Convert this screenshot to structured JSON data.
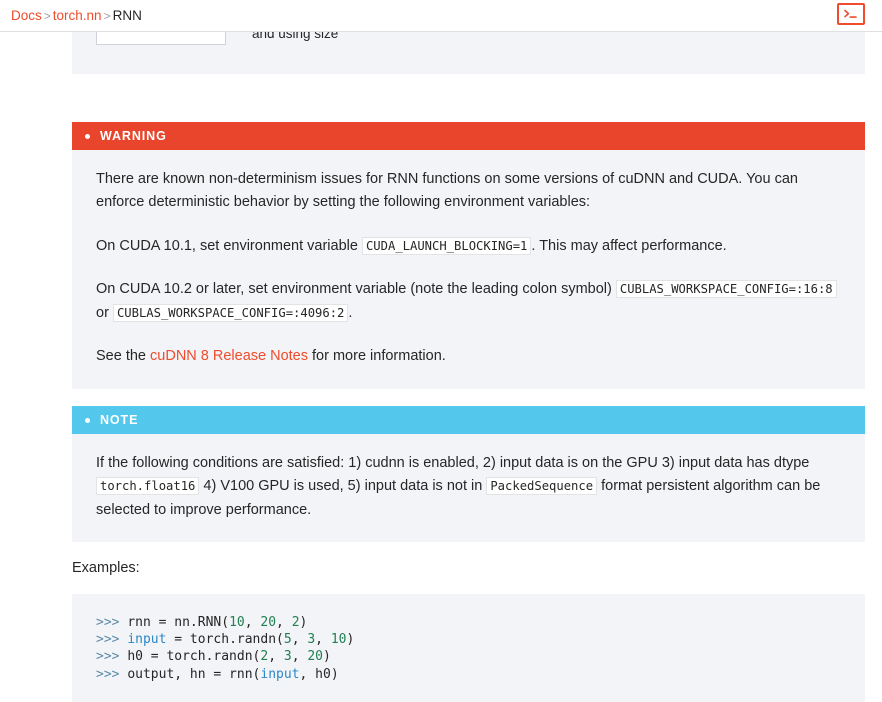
{
  "breadcrumb": {
    "items": [
      {
        "label": "Docs",
        "link": true
      },
      {
        "label": "torch.nn",
        "link": true
      },
      {
        "label": "RNN",
        "link": false
      }
    ],
    "separator": ">"
  },
  "topbar": {
    "shell_button_name": "Shell",
    "shell_glyph": ">_"
  },
  "colors": {
    "accent": "#ee4c2c",
    "warning": "#e8452c",
    "note": "#54c7ec",
    "admonition_bg": "#f3f4f7",
    "text": "#262626",
    "code_number": "#208050",
    "code_name": "#2b87c8",
    "code_prompt": "#5d8aa8"
  },
  "cutoff": {
    "trailing_text": "and using size"
  },
  "warning": {
    "title": "WARNING",
    "paragraphs": {
      "p1": "There are known non-determinism issues for RNN functions on some versions of cuDNN and CUDA. You can enforce deterministic behavior by setting the following environment variables:",
      "p2_before": "On CUDA 10.1, set environment variable",
      "p2_code": "CUDA_LAUNCH_BLOCKING=1",
      "p2_after": ". This may affect performance.",
      "p3_before": "On CUDA 10.2 or later, set environment variable (note the leading colon symbol)",
      "p3_code1": "CUBLAS_WORKSPACE_CONFIG=:16:8",
      "p3_mid": "or",
      "p3_code2": "CUBLAS_WORKSPACE_CONFIG=:4096:2",
      "p3_after": ".",
      "p4_before": "See the",
      "p4_link": "cuDNN 8 Release Notes",
      "p4_after": "for more information."
    }
  },
  "note": {
    "title": "NOTE",
    "body": {
      "before": "If the following conditions are satisfied: 1) cudnn is enabled, 2) input data is on the GPU 3) input data has dtype",
      "code1": "torch.float16",
      "mid": "4) V100 GPU is used, 5) input data is not in",
      "code2": "PackedSequence",
      "after": "format persistent algorithm can be selected to improve performance."
    }
  },
  "examples": {
    "label": "Examples:",
    "lines": [
      [
        {
          "t": ">>> ",
          "c": "prompt"
        },
        {
          "t": "rnn = nn.RNN(",
          "c": "plain"
        },
        {
          "t": "10",
          "c": "num"
        },
        {
          "t": ", ",
          "c": "plain"
        },
        {
          "t": "20",
          "c": "num"
        },
        {
          "t": ", ",
          "c": "plain"
        },
        {
          "t": "2",
          "c": "num"
        },
        {
          "t": ")",
          "c": "plain"
        }
      ],
      [
        {
          "t": ">>> ",
          "c": "prompt"
        },
        {
          "t": "input",
          "c": "name"
        },
        {
          "t": " = torch.randn(",
          "c": "plain"
        },
        {
          "t": "5",
          "c": "num"
        },
        {
          "t": ", ",
          "c": "plain"
        },
        {
          "t": "3",
          "c": "num"
        },
        {
          "t": ", ",
          "c": "plain"
        },
        {
          "t": "10",
          "c": "num"
        },
        {
          "t": ")",
          "c": "plain"
        }
      ],
      [
        {
          "t": ">>> ",
          "c": "prompt"
        },
        {
          "t": "h0 = torch.randn(",
          "c": "plain"
        },
        {
          "t": "2",
          "c": "num"
        },
        {
          "t": ", ",
          "c": "plain"
        },
        {
          "t": "3",
          "c": "num"
        },
        {
          "t": ", ",
          "c": "plain"
        },
        {
          "t": "20",
          "c": "num"
        },
        {
          "t": ")",
          "c": "plain"
        }
      ],
      [
        {
          "t": ">>> ",
          "c": "prompt"
        },
        {
          "t": "output, hn = rnn(",
          "c": "plain"
        },
        {
          "t": "input",
          "c": "name"
        },
        {
          "t": ", h0)",
          "c": "plain"
        }
      ]
    ]
  }
}
